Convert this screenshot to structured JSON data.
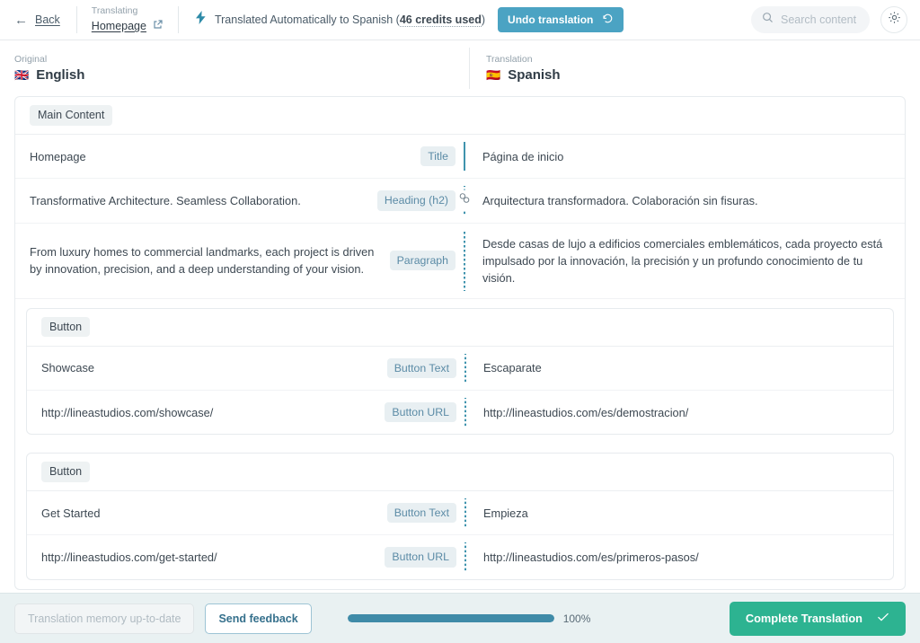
{
  "header": {
    "back_label": "Back",
    "translating_kicker": "Translating",
    "page_name": "Homepage",
    "external_link_icon": "external-link-icon",
    "bolt_icon": "lightning-bolt-icon",
    "auto_translated_prefix": "Translated Automatically to Spanish (",
    "credits_used": "46 credits used",
    "auto_translated_suffix": ")",
    "undo_label": "Undo translation",
    "undo_icon": "undo-arrow-icon",
    "search_placeholder": "Search content",
    "search_value": "",
    "search_icon": "search-icon",
    "settings_icon": "gear-icon"
  },
  "languages": {
    "original": {
      "kicker": "Original",
      "flag": "🇬🇧",
      "name": "English"
    },
    "translation": {
      "kicker": "Translation",
      "flag": "🇪🇸",
      "name": "Spanish"
    }
  },
  "content": {
    "section_label": "Main Content",
    "rows": [
      {
        "source": "Homepage",
        "type": "Title",
        "target": "Página de inicio",
        "divider": "solid",
        "sync_icon": ""
      },
      {
        "source": "Transformative Architecture. Seamless Collaboration.",
        "type": "Heading (h2)",
        "target": "Arquitectura transformadora. Colaboración sin fisuras.",
        "divider": "dotted",
        "sync_icon": "sync-icon"
      },
      {
        "source": "From luxury homes to commercial landmarks, each project is driven by innovation, precision, and a deep understanding of your vision.",
        "type": "Paragraph",
        "target": "Desde casas de lujo a edificios comerciales emblemáticos, cada proyecto está impulsado por la innovación, la precisión y un profundo conocimiento de tu visión.",
        "divider": "dotted",
        "sync_icon": ""
      }
    ],
    "button_groups": [
      {
        "label": "Button",
        "rows": [
          {
            "source": "Showcase",
            "type": "Button Text",
            "target": "Escaparate",
            "divider": "dotted"
          },
          {
            "source": "http://lineastudios.com/showcase/",
            "type": "Button URL",
            "target": "http://lineastudios.com/es/demostracion/",
            "divider": "dotted"
          }
        ]
      },
      {
        "label": "Button",
        "rows": [
          {
            "source": "Get Started",
            "type": "Button Text",
            "target": "Empieza",
            "divider": "dotted"
          },
          {
            "source": "http://lineastudios.com/get-started/",
            "type": "Button URL",
            "target": "http://lineastudios.com/es/primeros-pasos/",
            "divider": "dotted"
          }
        ]
      }
    ]
  },
  "footer": {
    "tm_label": "Translation memory up-to-date",
    "feedback_label": "Send feedback",
    "progress_percent": 100,
    "progress_label": "100%",
    "complete_label": "Complete Translation",
    "check_icon": "check-icon"
  },
  "colors": {
    "accent_teal": "#4ba3c3",
    "accent_green": "#2db391",
    "divider_teal": "#3f93ad",
    "chip_blue_text": "#5b8ba6",
    "footer_bg": "#e9f1f2"
  }
}
